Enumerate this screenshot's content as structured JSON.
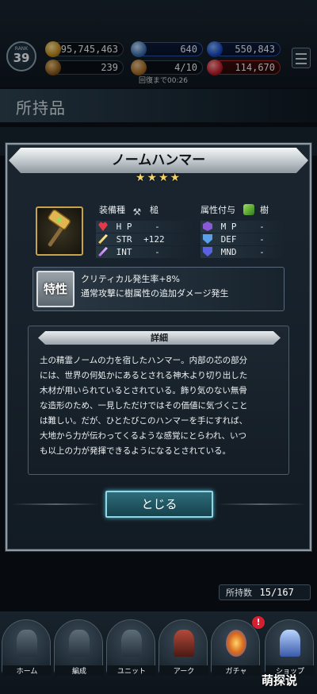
{
  "status": {
    "rank_label": "RANK",
    "rank_value": "39",
    "gil": "95,745,463",
    "visiore": "640",
    "lapis": "550,843",
    "chest": "239",
    "bag": "4/10",
    "stamina": "114,670",
    "timer": "回復まで00:26"
  },
  "page": {
    "title": "所持品"
  },
  "item": {
    "name": "ノームハンマー",
    "stars": "★★★★",
    "equip_type_label": "装備種",
    "equip_type_value": "槌",
    "element_label": "属性付与",
    "element_value": "樹",
    "stats": [
      {
        "name": "H P",
        "value": "-"
      },
      {
        "name": "STR",
        "value": "+122"
      },
      {
        "name": "INT",
        "value": "-"
      },
      {
        "name": "M P",
        "value": "-"
      },
      {
        "name": "DEF",
        "value": "-"
      },
      {
        "name": "MND",
        "value": "-"
      }
    ],
    "trait_badge": "特性",
    "trait_lines": [
      "クリティカル発生率+8%",
      "通常攻撃に樹属性の追加ダメージ発生"
    ],
    "detail_heading": "詳細",
    "detail_lines": [
      "土の精霊ノームの力を宿したハンマー。内部の芯の部分",
      "には、世界の何処かにあるとされる神木より切り出した",
      "木材が用いられているとされている。飾り気のない無骨",
      "な造形のため、一見しただけではその価値に気づくこと",
      "は難しい。だが、ひとたびこのハンマーを手にすれば、",
      "大地から力が伝わってくるような感覚にとらわれ、いつ",
      "も以上の力が発揮できるようになるとされている。"
    ],
    "close_label": "とじる"
  },
  "owned": {
    "label": "所持数",
    "value": "15/167"
  },
  "nav": [
    {
      "label": "ホーム"
    },
    {
      "label": "編成"
    },
    {
      "label": "ユニット"
    },
    {
      "label": "アーク"
    },
    {
      "label": "ガチャ"
    },
    {
      "label": "ショップ"
    }
  ],
  "nav_badge": "!",
  "watermark": "萌探说",
  "colors": {
    "accent": "#8fd6e6",
    "gold": "#c9a349",
    "star": "#f3d26a"
  }
}
